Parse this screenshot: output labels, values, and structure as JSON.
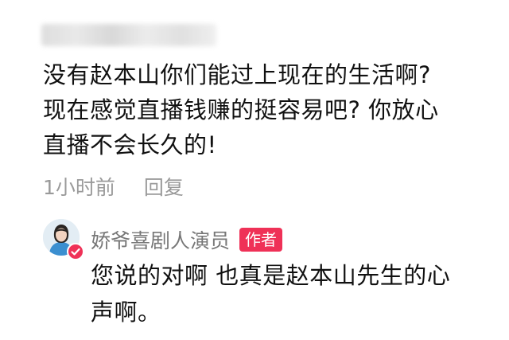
{
  "comment": {
    "username": "",
    "text": "没有赵本山你们能过上现在的生活啊?\n现在感觉直播钱赚的挺容易吧? 你放心\n直播不会长久的!",
    "time": "1小时前",
    "reply_label": "回复"
  },
  "reply": {
    "author_name": "娇爷喜剧人演员",
    "author_badge": "作者",
    "text": "您说的对啊 也真是赵本山先生的心\n声啊。",
    "avatar_icon": "person-avatar-icon",
    "badge_icon": "verified-check-icon"
  },
  "colors": {
    "badge_red": "#ef3157",
    "meta_gray": "#9a9a9a",
    "text_black": "#111111"
  }
}
